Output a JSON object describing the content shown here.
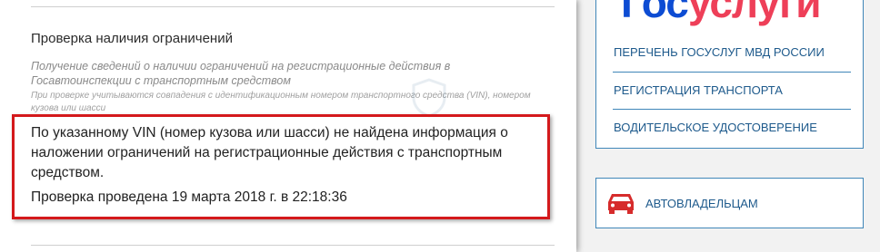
{
  "check": {
    "title": "Проверка наличия ограничений",
    "subtitle": "Получение сведений о наличии ограничений на регистрационные действия в Госавтоинспекции с транспортным средством",
    "note": "При проверке учитываются совпадения с идентификационным номером транспортного средства (VIN), номером кузова или шасси",
    "result_text": "По указанному VIN (номер кузова или шасси) не найдена информация о наложении ограничений на регистрационные действия с транспортным средством.",
    "result_date": "Проверка проведена 19 марта 2018 г. в 22:18:36",
    "highlight_color": "#d4191c"
  },
  "sidebar": {
    "logo": {
      "part1": "Гос",
      "part2": "услуги"
    },
    "links": [
      {
        "label": "ПЕРЕЧЕНЬ ГОСУСЛУГ МВД РОССИИ"
      },
      {
        "label": "РЕГИСТРАЦИЯ ТРАНСПОРТА"
      },
      {
        "label": "ВОДИТЕЛЬСКОЕ УДОСТОВЕРЕНИЕ"
      }
    ],
    "owner_link": {
      "label": "АВТОВЛАДЕЛЬЦАМ",
      "icon": "car-icon"
    }
  },
  "colors": {
    "link": "#1e5a8c",
    "card_border": "#3f86b8",
    "logo_blue": "#0d4cd3",
    "logo_red": "#ee3f58",
    "car_icon": "#d62b2b"
  }
}
